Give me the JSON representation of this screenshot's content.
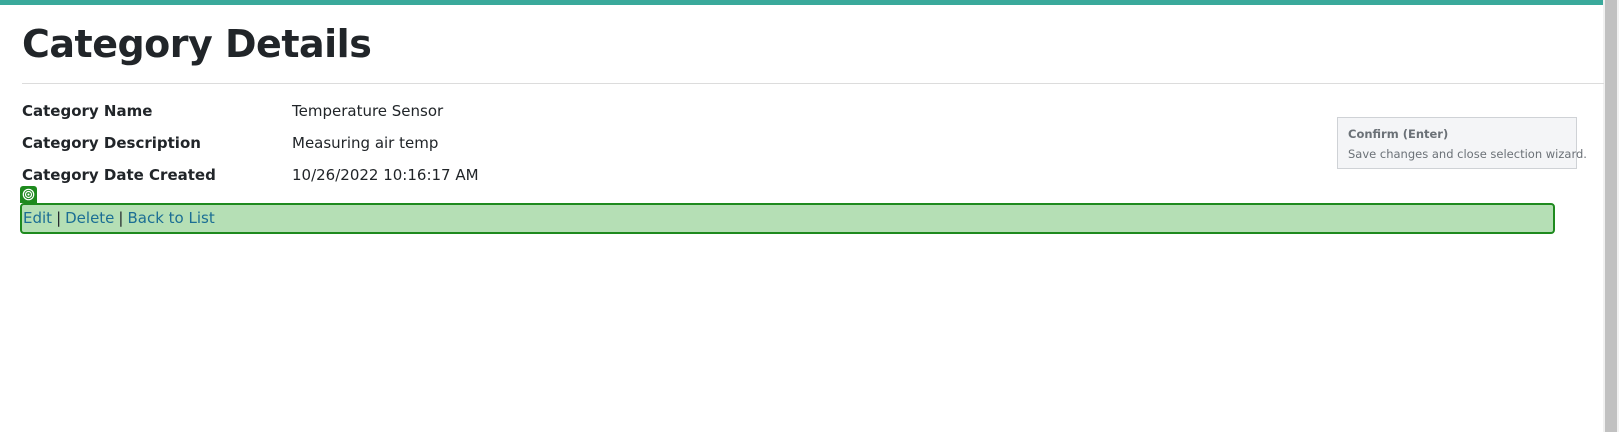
{
  "page": {
    "title": "Category Details"
  },
  "details": [
    {
      "label": "Category Name",
      "value": "Temperature Sensor"
    },
    {
      "label": "Category Description",
      "value": "Measuring air temp"
    },
    {
      "label": "Category Date Created",
      "value": "10/26/2022 10:16:17 AM"
    }
  ],
  "actions": {
    "edit": "Edit",
    "delete": "Delete",
    "back": "Back to List",
    "separator": "|"
  },
  "tooltip": {
    "title": "Confirm (Enter)",
    "description": "Save changes and close selection wizard."
  },
  "colors": {
    "accent_bar": "#3aa99b",
    "link": "#1b6e94",
    "selection_fill": "#b5dfb5",
    "selection_border": "#1e8a1e"
  },
  "icons": {
    "target_marker": "target-icon"
  }
}
